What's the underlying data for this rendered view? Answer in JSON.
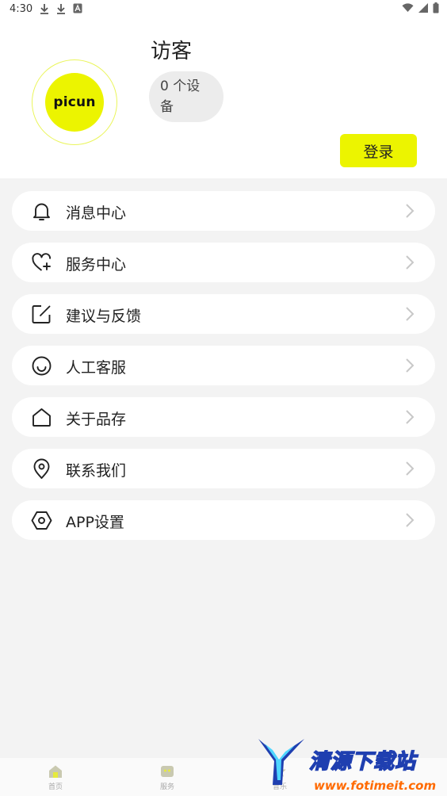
{
  "status_bar": {
    "time": "4:30",
    "left_icons": [
      "download-icon",
      "download-icon",
      "a-badge-icon"
    ],
    "right_icons": [
      "wifi-icon",
      "signal-icon",
      "battery-icon"
    ]
  },
  "profile": {
    "avatar_text": "picun",
    "name": "访客",
    "device_count": "0 个设备",
    "login_label": "登录",
    "accent_color": "#ecf400"
  },
  "menu": {
    "items": [
      {
        "label": "消息中心",
        "icon": "bell-icon"
      },
      {
        "label": "服务中心",
        "icon": "heart-plus-icon"
      },
      {
        "label": "建议与反馈",
        "icon": "edit-icon"
      },
      {
        "label": "人工客服",
        "icon": "smile-icon"
      },
      {
        "label": "关于品存",
        "icon": "home-icon"
      },
      {
        "label": "联系我们",
        "icon": "location-icon"
      },
      {
        "label": "APP设置",
        "icon": "settings-hex-icon"
      }
    ]
  },
  "tabbar": {
    "tabs": [
      {
        "label": "首页",
        "icon": "home-tab-icon"
      },
      {
        "label": "服务",
        "icon": "service-tab-icon"
      },
      {
        "label": "音乐",
        "icon": "music-tab-icon"
      }
    ]
  },
  "watermark": {
    "title": "清源下载站",
    "url": "www.fotimeit.com"
  }
}
